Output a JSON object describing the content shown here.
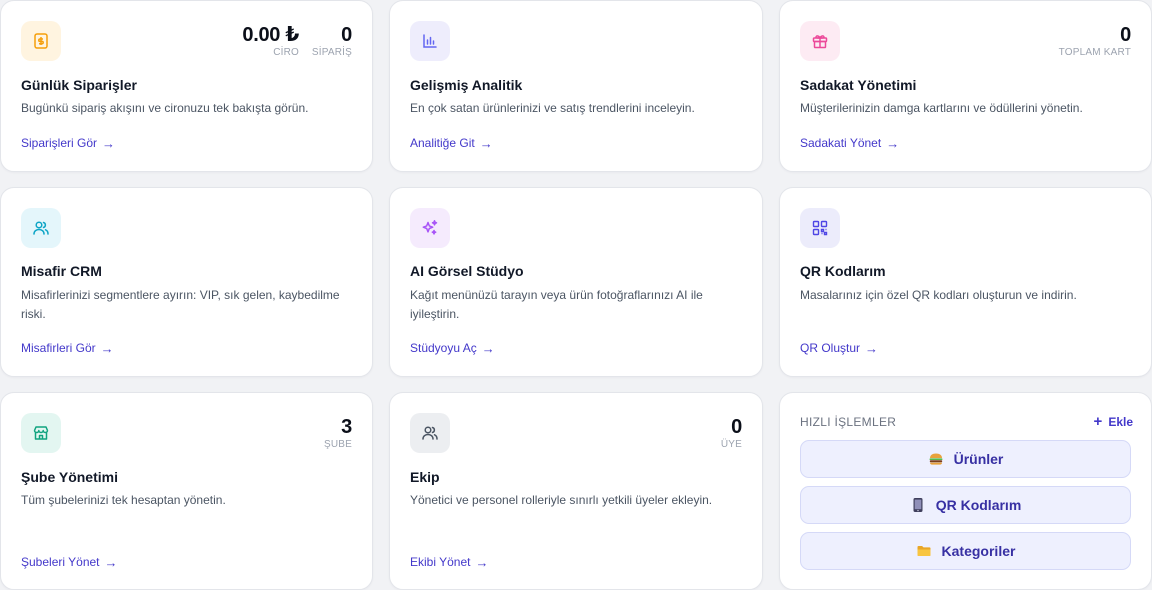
{
  "orders": {
    "title": "Günlük Siparişler",
    "desc": "Bugünkü sipariş akışını ve cironuzu tek bakışta görün.",
    "link": "Siparişleri Gör",
    "revenue_value": "0.00 ₺",
    "revenue_label": "CİRO",
    "orders_value": "0",
    "orders_label": "SİPARİŞ",
    "icon": "money-icon"
  },
  "analytics": {
    "title": "Gelişmiş Analitik",
    "desc": "En çok satan ürünlerinizi ve satış trendlerini inceleyin.",
    "link": "Analitiğe Git",
    "icon": "bar-chart-icon"
  },
  "loyalty": {
    "title": "Sadakat Yönetimi",
    "desc": "Müşterilerinizin damga kartlarını ve ödüllerini yönetin.",
    "link": "Sadakati Yönet",
    "stat_value": "0",
    "stat_label": "TOPLAM KART",
    "icon": "gift-icon"
  },
  "crm": {
    "title": "Misafir CRM",
    "desc": "Misafirlerinizi segmentlere ayırın: VIP, sık gelen, kaybedilme riski.",
    "link": "Misafirleri Gör",
    "icon": "users-icon"
  },
  "ai": {
    "title": "AI Görsel Stüdyo",
    "desc": "Kağıt menünüzü tarayın veya ürün fotoğraflarınızı AI ile iyileştirin.",
    "link": "Stüdyoyu Aç",
    "icon": "sparkles-icon"
  },
  "qr": {
    "title": "QR Kodlarım",
    "desc": "Masalarınız için özel QR kodları oluşturun ve indirin.",
    "link": "QR Oluştur",
    "icon": "qr-code-icon"
  },
  "branch": {
    "title": "Şube Yönetimi",
    "desc": "Tüm şubelerinizi tek hesaptan yönetin.",
    "link": "Şubeleri Yönet",
    "stat_value": "3",
    "stat_label": "ŞUBE",
    "icon": "store-icon"
  },
  "team": {
    "title": "Ekip",
    "desc": "Yönetici ve personel rolleriyle sınırlı yetkili üyeler ekleyin.",
    "link": "Ekibi Yönet",
    "stat_value": "0",
    "stat_label": "ÜYE",
    "icon": "team-icon"
  },
  "quick": {
    "header": "HIZLI İŞLEMLER",
    "add_label": "Ekle",
    "buttons": [
      {
        "label": "Ürünler",
        "icon": "burger-icon"
      },
      {
        "label": "QR Kodlarım",
        "icon": "phone-icon"
      },
      {
        "label": "Kategoriler",
        "icon": "folder-icon"
      }
    ]
  },
  "colors": {
    "accent": "#4338ca",
    "orders_bg": "#fff4e0",
    "analytics_bg": "#eeedfc",
    "loyalty_bg": "#fdebf3",
    "crm_bg": "#e4f6fb",
    "ai_bg": "#f5ebfd",
    "qr_bg": "#ececfb",
    "branch_bg": "#e3f6f1",
    "team_bg": "#eceef1"
  }
}
